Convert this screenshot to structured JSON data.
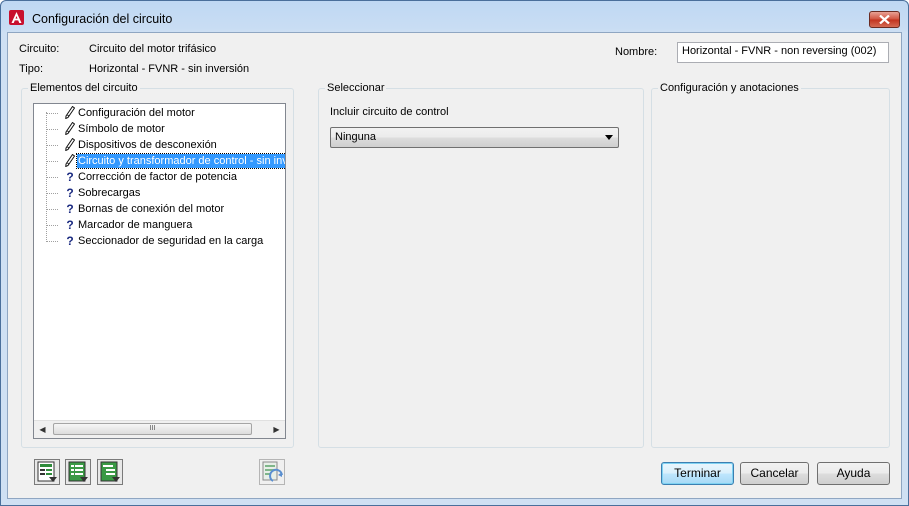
{
  "window": {
    "title": "Configuración del circuito"
  },
  "header": {
    "circuito_label": "Circuito:",
    "circuito_value": "Circuito del motor trifásico",
    "tipo_label": "Tipo:",
    "tipo_value": "Horizontal - FVNR - sin inversión",
    "nombre_label": "Nombre:",
    "nombre_value": "Horizontal - FVNR - non reversing (002)"
  },
  "groups": {
    "elementos": "Elementos del circuito",
    "seleccionar": "Seleccionar",
    "configuracion": "Configuración y anotaciones"
  },
  "tree": {
    "items": [
      {
        "label": "Configuración del motor",
        "icon": "pencil-icon"
      },
      {
        "label": "Símbolo de motor",
        "icon": "pencil-icon"
      },
      {
        "label": "Dispositivos de desconexión",
        "icon": "pencil-icon"
      },
      {
        "label": "Circuito y transformador de control - sin inver",
        "icon": "pencil-icon",
        "selected": true
      },
      {
        "label": "Corrección de factor de potencia",
        "icon": "question-icon",
        "glyph": "?"
      },
      {
        "label": "Sobrecargas",
        "icon": "question-icon",
        "glyph": "?"
      },
      {
        "label": "Bornas de conexión del motor",
        "icon": "question-icon",
        "glyph": "?"
      },
      {
        "label": "Marcador de manguera",
        "icon": "question-icon",
        "glyph": "?"
      },
      {
        "label": "Seccionador de seguridad en la carga",
        "icon": "question-icon",
        "glyph": "?"
      }
    ],
    "scroll_thumb": "III"
  },
  "seleccionar": {
    "incluir_label": "Incluir circuito de control",
    "incluir_value": "Ninguna"
  },
  "buttons": {
    "terminar": "Terminar",
    "cancelar": "Cancelar",
    "ayuda": "Ayuda"
  },
  "colors": {
    "selection": "#3399ff",
    "accent": "#c1321e"
  }
}
